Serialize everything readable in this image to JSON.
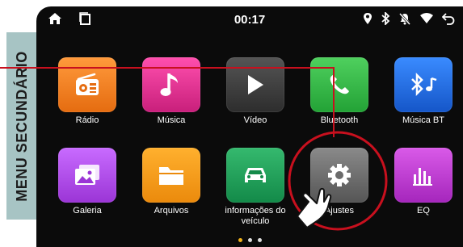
{
  "side_label": "MENU SECUNDÁRIO",
  "statusbar": {
    "time": "00:17",
    "left_icons": [
      "home-icon",
      "recent-apps-icon"
    ],
    "right_icons": [
      "location-pin-icon",
      "bluetooth-icon",
      "mute-icon",
      "wifi-icon",
      "back-icon"
    ]
  },
  "apps": [
    {
      "label": "Rádio",
      "icon": "radio-icon",
      "color": "#f08020"
    },
    {
      "label": "Música",
      "icon": "music-note-icon",
      "color": "#e0308f"
    },
    {
      "label": "Vídeo",
      "icon": "play-icon",
      "color": "#3f3f3f"
    },
    {
      "label": "Bluetooth",
      "icon": "phone-icon",
      "color": "#38b84a"
    },
    {
      "label": "Música BT",
      "icon": "bluetooth-music-icon",
      "color": "#1f6ee6"
    },
    {
      "label": "Galeria",
      "icon": "gallery-icon",
      "color": "#b04ce6"
    },
    {
      "label": "Arquivos",
      "icon": "folder-icon",
      "color": "#f09a18"
    },
    {
      "label": "informações do veículo",
      "icon": "car-icon",
      "color": "#22a05c"
    },
    {
      "label": "Ajustes",
      "icon": "settings-gear-icon",
      "color": "#6b6b6b"
    },
    {
      "label": "EQ",
      "icon": "equalizer-icon",
      "color": "#c43cd2"
    }
  ],
  "page_indicator": {
    "pages": 3,
    "current": 1
  },
  "colors": {
    "callout_red": "#c8101e",
    "side_label_bg": "#a7c4c4"
  }
}
